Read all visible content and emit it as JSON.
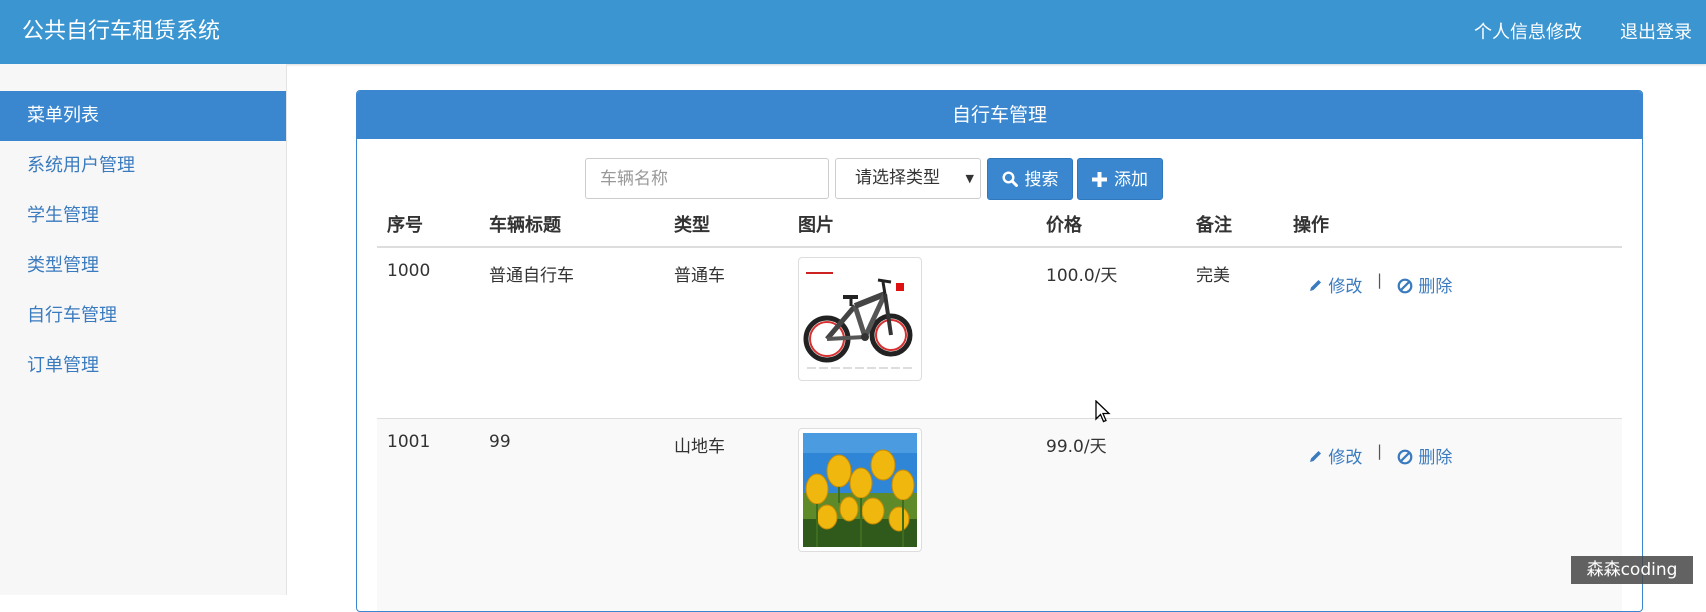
{
  "app_title": "公共自行车租赁系统",
  "nav": {
    "profile_label": "个人信息修改",
    "logout_label": "退出登录"
  },
  "sidebar": {
    "header": "菜单列表",
    "items": [
      {
        "label": "系统用户管理"
      },
      {
        "label": "学生管理"
      },
      {
        "label": "类型管理"
      },
      {
        "label": "自行车管理"
      },
      {
        "label": "订单管理"
      }
    ]
  },
  "panel": {
    "title": "自行车管理",
    "search": {
      "placeholder": "车辆名称",
      "value": ""
    },
    "type_select": {
      "selected": "请选择类型"
    },
    "search_button_label": "搜索",
    "add_button_label": "添加",
    "columns": [
      "序号",
      "车辆标题",
      "类型",
      "图片",
      "价格",
      "备注",
      "操作"
    ],
    "rows": [
      {
        "id": "1000",
        "title": "普通自行车",
        "type": "普通车",
        "image": "bicycle-photo",
        "price": "100.0/天",
        "remark": "完美",
        "edit_label": "修改",
        "delete_label": "删除"
      },
      {
        "id": "1001",
        "title": "99",
        "type": "山地车",
        "image": "tulips-photo",
        "price": "99.0/天",
        "remark": "",
        "edit_label": "修改",
        "delete_label": "删除"
      }
    ],
    "action_separator": "|"
  },
  "icons": {
    "search": "magnifier-icon",
    "add": "plus-icon",
    "edit": "pencil-icon",
    "delete": "ban-icon"
  },
  "colors": {
    "navbar": "#3a95d0",
    "primary": "#3a87cf",
    "link": "#3a7bbf"
  },
  "watermark": "森森coding"
}
